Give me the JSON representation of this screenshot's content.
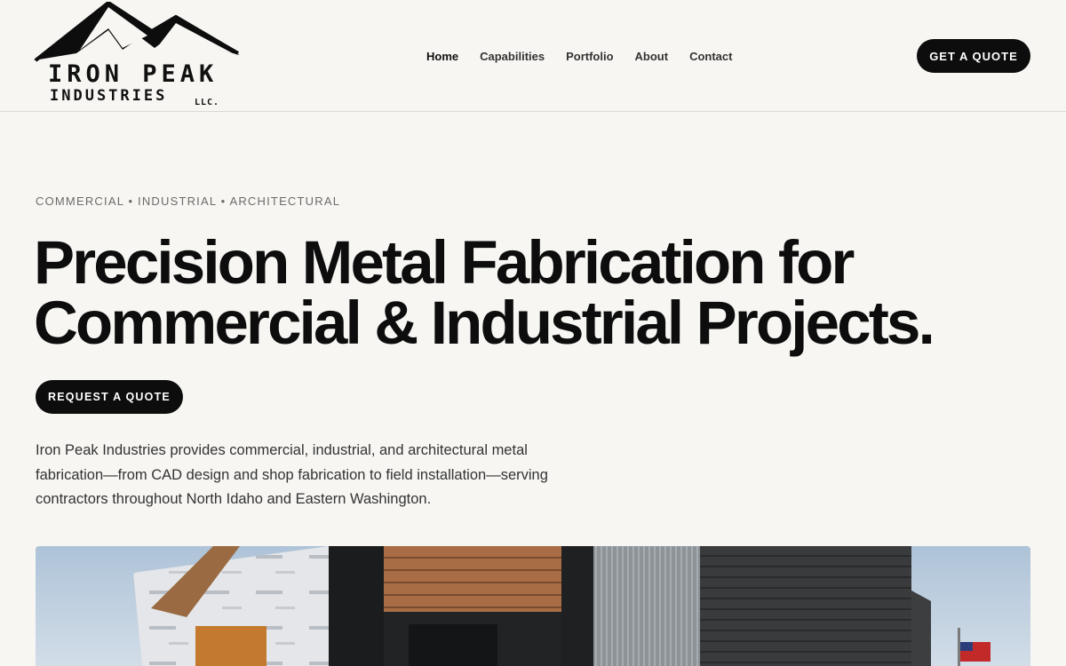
{
  "logo": {
    "line1": "IRON PEAK",
    "line2": "INDUSTRIES",
    "line3": "LLC.",
    "icon": "mountain-peaks-icon"
  },
  "nav": {
    "items": [
      {
        "label": "Home",
        "active": true
      },
      {
        "label": "Capabilities",
        "active": false
      },
      {
        "label": "Portfolio",
        "active": false
      },
      {
        "label": "About",
        "active": false
      },
      {
        "label": "Contact",
        "active": false
      }
    ]
  },
  "header": {
    "cta_label": "GET A QUOTE"
  },
  "hero": {
    "eyebrow": "COMMERCIAL • INDUSTRIAL • ARCHITECTURAL",
    "headline": "Precision Metal Fabrication for Commercial & Industrial Projects.",
    "cta_label": "REQUEST A QUOTE",
    "intro": "Iron Peak Industries provides commercial, industrial, and architectural metal fabrication—from CAD design and shop fabrication to field installation—serving contractors throughout North Idaho and Eastern Washington.",
    "image": "building-construction-photo"
  },
  "colors": {
    "background": "#f7f6f3",
    "ink": "#0d0d0d",
    "muted": "#6b6b6b",
    "button": "#0d0d0d",
    "button_text": "#ffffff"
  }
}
